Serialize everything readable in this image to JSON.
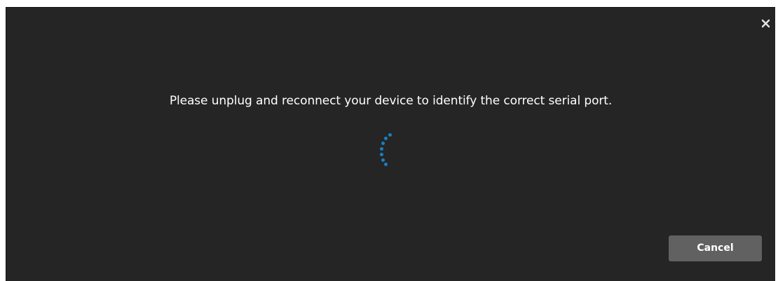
{
  "dialog": {
    "message": "Please unplug and reconnect your device to identify the correct serial port.",
    "cancel_label": "Cancel",
    "close_icon": "close-icon",
    "spinner_icon": "loading-spinner",
    "colors": {
      "background": "#252525",
      "text": "#ffffff",
      "spinner": "#1a7fc1",
      "button": "#616161"
    }
  }
}
